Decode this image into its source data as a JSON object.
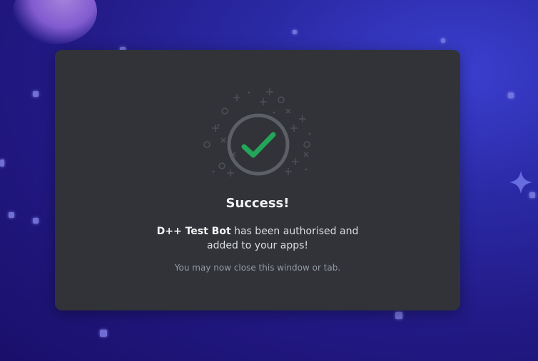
{
  "background": {
    "accent": "#2b2aa6"
  },
  "dialog": {
    "icon": "success-check-icon",
    "title": "Success!",
    "bot_name": "D++ Test Bot",
    "message_line1_rest": "has been authorised and",
    "message_line2": "added to your apps!",
    "hint": "You may now close this window or tab.",
    "colors": {
      "card": "#313338",
      "check": "#23a55a",
      "ring": "#5c5f66"
    }
  }
}
